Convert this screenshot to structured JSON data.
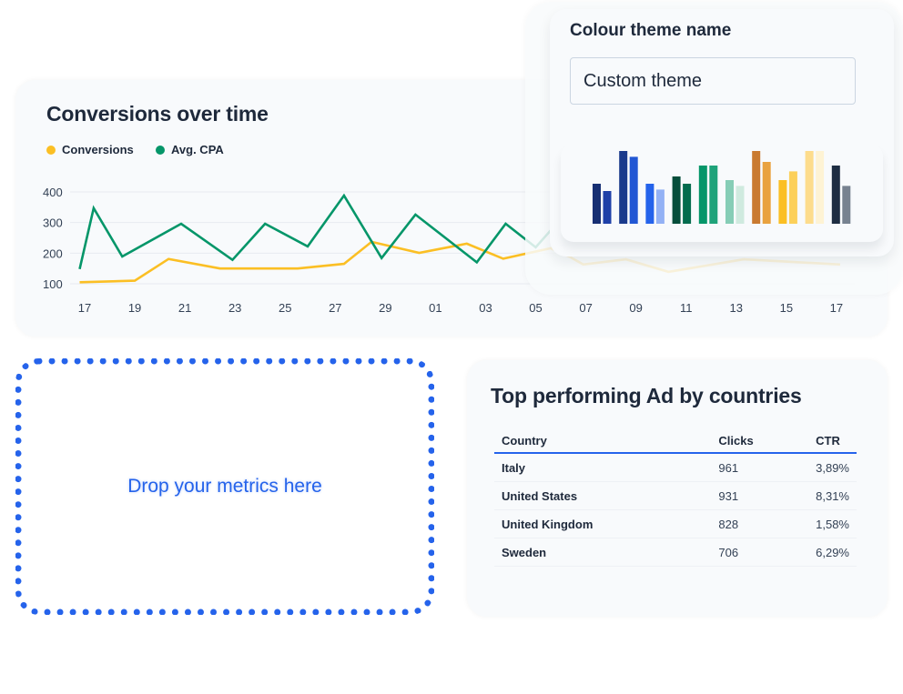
{
  "line_chart_card": {
    "title": "Conversions over time",
    "legend": [
      {
        "label": "Conversions",
        "color": "#fbbf24"
      },
      {
        "label": "Avg. CPA",
        "color": "#059669"
      }
    ]
  },
  "color_theme_popover": {
    "title": "Colour theme name",
    "input_value": "Custom theme",
    "palette_groups": [
      {
        "colors": [
          "#172f73",
          "#1e40a8"
        ],
        "levels": [
          0.55,
          0.45
        ]
      },
      {
        "colors": [
          "#1a3a8c",
          "#2257d4"
        ],
        "levels": [
          1.0,
          0.92
        ]
      },
      {
        "colors": [
          "#2563eb",
          "#93b1f5"
        ],
        "levels": [
          0.55,
          0.47
        ]
      },
      {
        "colors": [
          "#064e3b",
          "#046c4e"
        ],
        "levels": [
          0.65,
          0.55
        ]
      },
      {
        "colors": [
          "#059669",
          "#1fa37a"
        ],
        "levels": [
          0.8,
          0.8
        ]
      },
      {
        "colors": [
          "#86cdb6",
          "#cfeadf"
        ],
        "levels": [
          0.6,
          0.52
        ]
      },
      {
        "colors": [
          "#c97a30",
          "#e9a23f"
        ],
        "levels": [
          1.0,
          0.85
        ]
      },
      {
        "colors": [
          "#fbbf24",
          "#fcd05a"
        ],
        "levels": [
          0.6,
          0.72
        ]
      },
      {
        "colors": [
          "#fddc8c",
          "#fef3d4"
        ],
        "levels": [
          1.0,
          1.0
        ]
      },
      {
        "colors": [
          "#1e2d42",
          "#778290"
        ],
        "levels": [
          0.8,
          0.52
        ]
      }
    ]
  },
  "dropzone": {
    "label": "Drop your metrics here"
  },
  "table_card": {
    "title": "Top performing Ad by countries",
    "columns": [
      "Country",
      "Clicks",
      "CTR"
    ],
    "rows": [
      {
        "country": "Italy",
        "clicks": "961",
        "ctr": "3,89%"
      },
      {
        "country": "United States",
        "clicks": "931",
        "ctr": "8,31%"
      },
      {
        "country": "United Kingdom",
        "clicks": "828",
        "ctr": "1,58%"
      },
      {
        "country": "Sweden",
        "clicks": "706",
        "ctr": "6,29%"
      }
    ]
  },
  "chart_data": {
    "type": "line",
    "title": "Conversions over time",
    "xlabel": "",
    "ylabel": "",
    "x_tick_labels": [
      "17",
      "19",
      "21",
      "23",
      "25",
      "27",
      "29",
      "01",
      "03",
      "05",
      "07",
      "09",
      "11",
      "13",
      "15",
      "17"
    ],
    "x_tick_day_index": [
      0,
      2,
      4,
      6,
      8,
      10,
      12,
      14,
      16,
      18,
      20,
      22,
      24,
      26,
      28,
      30
    ],
    "y_ticks": [
      100,
      200,
      300,
      400
    ],
    "ylim": [
      100,
      400
    ],
    "xlim_day_index": [
      0,
      30
    ],
    "grid": true,
    "legend_position": "top-left",
    "series": [
      {
        "name": "Conversions",
        "color": "#fbbf24",
        "points": [
          [
            -0.2,
            105
          ],
          [
            2.0,
            110
          ],
          [
            3.35,
            181
          ],
          [
            5.4,
            150
          ],
          [
            8.5,
            150
          ],
          [
            10.35,
            165
          ],
          [
            11.45,
            237
          ],
          [
            13.35,
            201
          ],
          [
            15.25,
            231
          ],
          [
            16.7,
            182
          ],
          [
            18.6,
            216
          ],
          [
            19.4,
            186
          ],
          [
            19.9,
            163
          ],
          [
            21.6,
            180
          ],
          [
            23.3,
            139
          ],
          [
            26.3,
            180
          ],
          [
            30.15,
            163
          ]
        ]
      },
      {
        "name": "Avg. CPA",
        "color": "#059669",
        "points": [
          [
            -0.2,
            148
          ],
          [
            0.36,
            347
          ],
          [
            1.5,
            189
          ],
          [
            3.85,
            296
          ],
          [
            5.9,
            178
          ],
          [
            7.2,
            296
          ],
          [
            8.9,
            222
          ],
          [
            10.35,
            388
          ],
          [
            11.85,
            184
          ],
          [
            13.2,
            326
          ],
          [
            15.65,
            170
          ],
          [
            16.8,
            296
          ],
          [
            18.0,
            219
          ],
          [
            18.6,
            275
          ]
        ]
      }
    ]
  }
}
